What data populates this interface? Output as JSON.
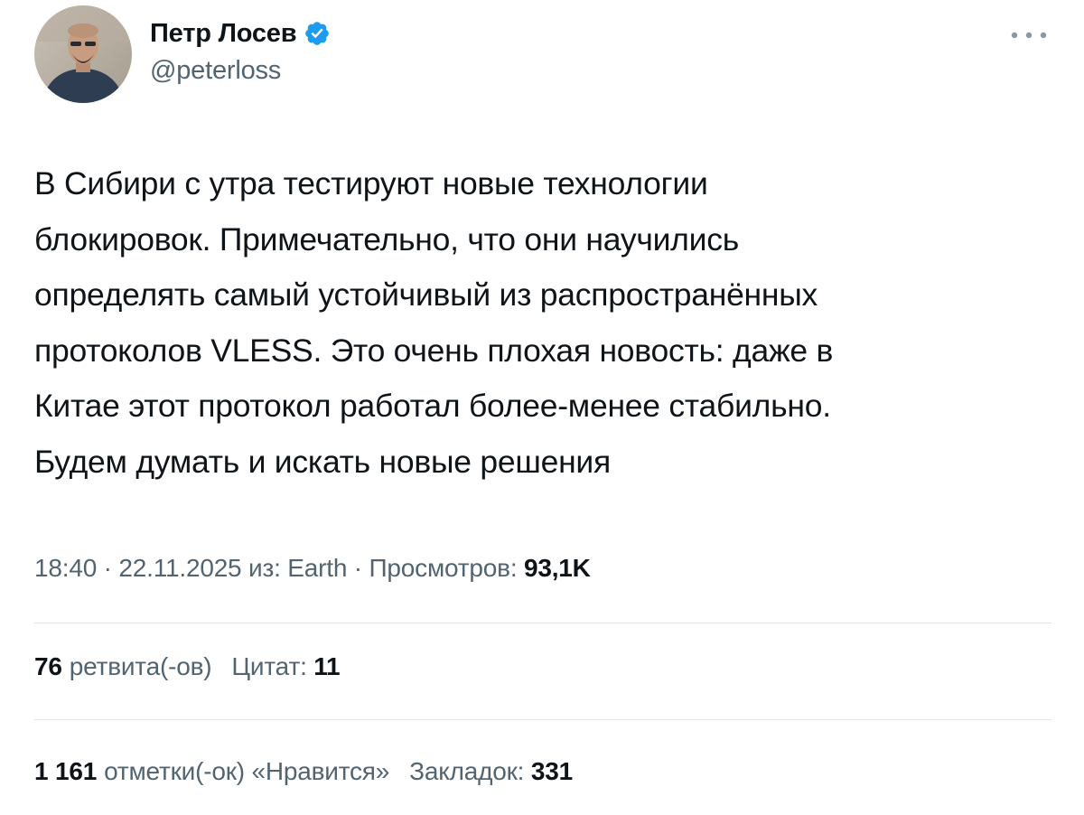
{
  "author": {
    "display_name": "Петр Лосев",
    "handle": "@peterloss",
    "verified": true,
    "avatar_icon": "person-avatar",
    "verified_icon": "verified-badge-icon",
    "badge_color": "#1d9bf0"
  },
  "menu": {
    "icon": "more-horizontal-icon"
  },
  "tweet": {
    "text": "В Сибири с утра тестируют новые технологии\nблокировок. Примечательно, что они научились\nопределять самый устойчивый из распространённых\nпротоколов VLESS. Это очень плохая новость: даже в\nКитае этот протокол работал более-менее стабильно.\nБудем думать и искать новые решения"
  },
  "meta": {
    "time": "18:40",
    "separator1": " · ",
    "date": "22.11.2025",
    "source_prefix": " из: ",
    "source": "Earth",
    "separator2": " · ",
    "views_label": "Просмотров: ",
    "views_value": "93,1K"
  },
  "stats": {
    "retweets": {
      "count": "76",
      "label": "ретвита(-ов)"
    },
    "quotes": {
      "label": "Цитат: ",
      "count": "11"
    },
    "likes": {
      "count": "1 161",
      "label": "отметки(-ок) «Нравится»"
    },
    "bookmarks": {
      "label": "Закладок: ",
      "count": "331"
    }
  },
  "colors": {
    "text_primary": "#0f1419",
    "text_secondary": "#536471",
    "divider": "#e1e6ea",
    "accent": "#1d9bf0"
  }
}
